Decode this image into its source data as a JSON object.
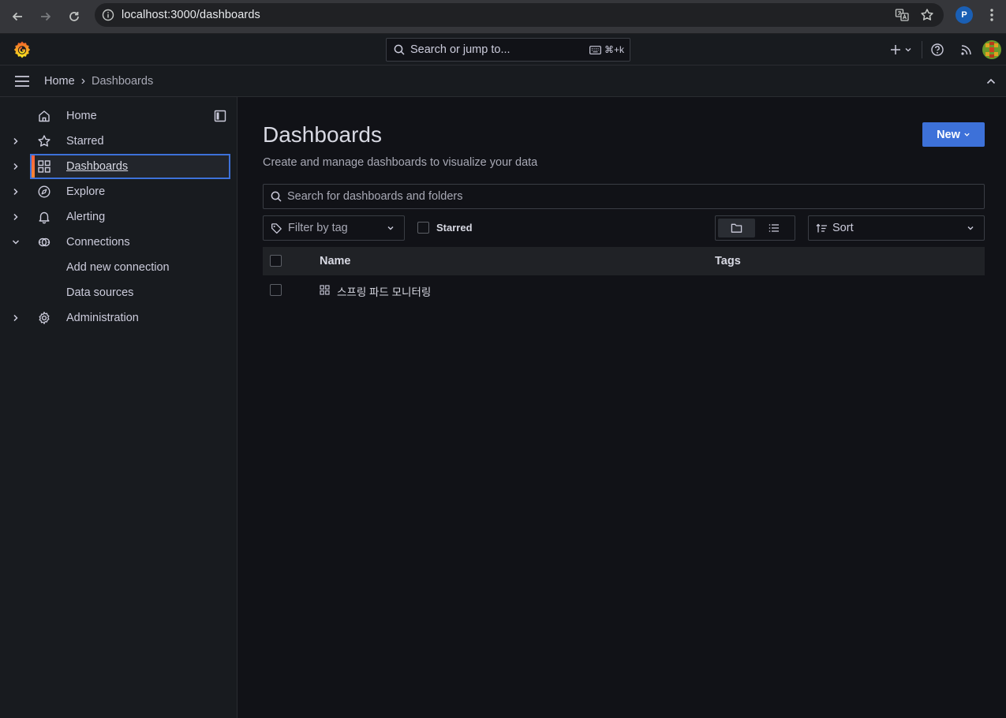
{
  "browser": {
    "url_host": "localhost",
    "url_rest": ":3000/dashboards",
    "profile_initial": "P"
  },
  "topbar": {
    "search_placeholder": "Search or jump to...",
    "shortcut": "⌘+k"
  },
  "breadcrumb": {
    "home": "Home",
    "separator": "›",
    "current": "Dashboards"
  },
  "sidebar": {
    "items": [
      {
        "label": "Home",
        "icon": "home-icon"
      },
      {
        "label": "Starred",
        "icon": "star-icon"
      },
      {
        "label": "Dashboards",
        "icon": "apps-icon",
        "active": true
      },
      {
        "label": "Explore",
        "icon": "compass-icon"
      },
      {
        "label": "Alerting",
        "icon": "bell-icon"
      },
      {
        "label": "Connections",
        "icon": "connections-icon",
        "expanded": true
      },
      {
        "label": "Add new connection"
      },
      {
        "label": "Data sources"
      },
      {
        "label": "Administration",
        "icon": "cog-icon"
      }
    ]
  },
  "main": {
    "title": "Dashboards",
    "subtitle": "Create and manage dashboards to visualize your data",
    "new_button": "New",
    "search_placeholder": "Search for dashboards and folders",
    "tag_filter_placeholder": "Filter by tag",
    "starred_label": "Starred",
    "sort_label": "Sort",
    "columns": {
      "name": "Name",
      "tags": "Tags"
    },
    "rows": [
      {
        "name": "스프링 파드 모니터링",
        "tags": ""
      }
    ]
  },
  "colors": {
    "accent_blue": "#3d71d9",
    "background": "#111217",
    "panel": "#181b1f"
  }
}
